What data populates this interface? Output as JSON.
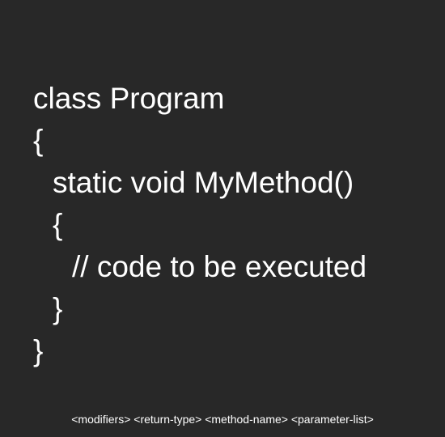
{
  "code": {
    "lines": [
      "class Program",
      "{",
      "static void MyMethod()",
      "{",
      "// code to be executed",
      "}",
      "}"
    ]
  },
  "caption": {
    "text": "<modifiers> <return-type> <method-name> <parameter-list>"
  },
  "colors": {
    "background": "#282828",
    "text": "#ffffff"
  }
}
